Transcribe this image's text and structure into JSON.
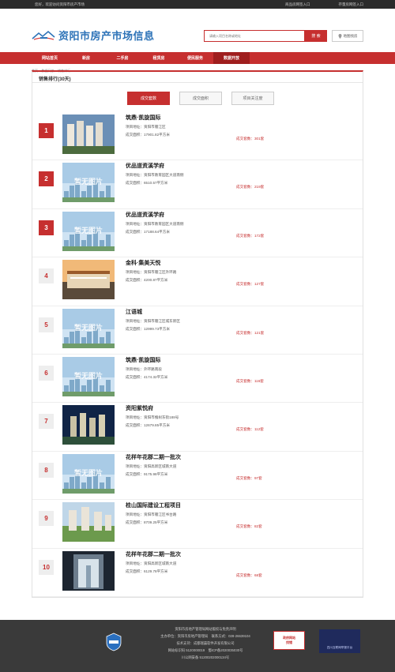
{
  "topbar": {
    "greeting": "您好，欢迎访问资阳市房产市场",
    "link1": "商品房网签入口",
    "link2": "存量房网签入口"
  },
  "header": {
    "title": "资阳市房产市场信息",
    "logo_text": "资阳市房产市场"
  },
  "search": {
    "placeholder": "请输入项目名称或地址",
    "button": "搜 索",
    "map_button": "地图找房"
  },
  "nav": [
    {
      "label": "网站首页"
    },
    {
      "label": "新房"
    },
    {
      "label": "二手房"
    },
    {
      "label": "租赁房"
    },
    {
      "label": "便民服务"
    },
    {
      "label": "数据开放",
      "active": true
    }
  ],
  "breadcrumb": "首页 > 数据开放 > 销售排行",
  "panel_title": "销售排行(30天)",
  "tabs": [
    {
      "label": "成交套数",
      "active": true
    },
    {
      "label": "成交面积"
    },
    {
      "label": "项目关注度"
    }
  ],
  "labels": {
    "addr_prefix": "项目地址：",
    "area_prefix": "成交面积：",
    "area_unit": "平方米",
    "sales_prefix": "成交套数：",
    "sales_unit": "套",
    "no_image": "暂无图片"
  },
  "projects": [
    {
      "rank": "1",
      "name": "筑鼎·凯旋国际",
      "addr": "项目地址：资阳市雁江区",
      "area": "成交面积：17901.82平方米",
      "sales": "成交套数：301套",
      "image": "photo-blue"
    },
    {
      "rank": "2",
      "name": "优品道资溪学府",
      "addr": "项目地址：资阳市教育园区大道南侧",
      "area": "成交面积：6510.57平方米",
      "sales": "成交套数：219套",
      "image": "placeholder"
    },
    {
      "rank": "3",
      "name": "优品道资溪学府",
      "addr": "项目地址：资阳市教育园区大道南侧",
      "area": "成交面积：17188.64平方米",
      "sales": "成交套数：172套",
      "image": "placeholder"
    },
    {
      "rank": "4",
      "name": "金科·集美天悦",
      "addr": "项目地址：资阳市雁江区外环路",
      "area": "成交面积：4200.87平方米",
      "sales": "成交套数：127套",
      "image": "photo-orange"
    },
    {
      "rank": "5",
      "name": "江语城",
      "addr": "项目地址：资阳市雁江区城东新区",
      "area": "成交面积：12999.73平方米",
      "sales": "成交套数：121套",
      "image": "placeholder"
    },
    {
      "rank": "6",
      "name": "筑鼎·凯旋国际",
      "addr": "项目地址：外环路南段",
      "area": "成交面积：4174.32平方米",
      "sales": "成交套数：116套",
      "image": "placeholder"
    },
    {
      "rank": "7",
      "name": "资阳紫悦府",
      "addr": "项目地址：资阳市槐树东街188号",
      "area": "成交面积：12679.85平方米",
      "sales": "成交套数：112套",
      "image": "photo-night"
    },
    {
      "rank": "8",
      "name": "花样年花郡二期一批次",
      "addr": "项目地址：资阳高新区城南大道",
      "area": "成交面积：9175.98平方米",
      "sales": "成交套数：97套",
      "image": "placeholder"
    },
    {
      "rank": "9",
      "name": "桂山国际建设工程项目",
      "addr": "项目地址：资阳市雁江区书台路",
      "area": "成交面积：8709.25平方米",
      "sales": "成交套数：82套",
      "image": "photo-green"
    },
    {
      "rank": "10",
      "name": "花样年花郡二期一批次",
      "addr": "项目地址：资阳高新区城南大道",
      "area": "成交面积：6129.78平方米",
      "sales": "成交套数：68套",
      "image": "photo-lobby"
    }
  ],
  "footer": {
    "line1": "资阳市房地产管理局网站版权与免责声明",
    "line2": "主办单位：资阳市房地产管理局　联系方式：028-26639104",
    "line3": "技术支持：成都瑞晨软件开发有限公司",
    "line4": "网站标识码 5120000019　蜀ICP备2020035030号",
    "line5": "川公网安备 51200202000134号",
    "badge2_top": "政府网站",
    "badge2_bottom": "找错",
    "badge3": "四川互联网举报平台"
  },
  "colors": {
    "brand_red": "#c62f2f",
    "brand_blue": "#2d73b8",
    "footer_bg": "#3a3a3a"
  }
}
